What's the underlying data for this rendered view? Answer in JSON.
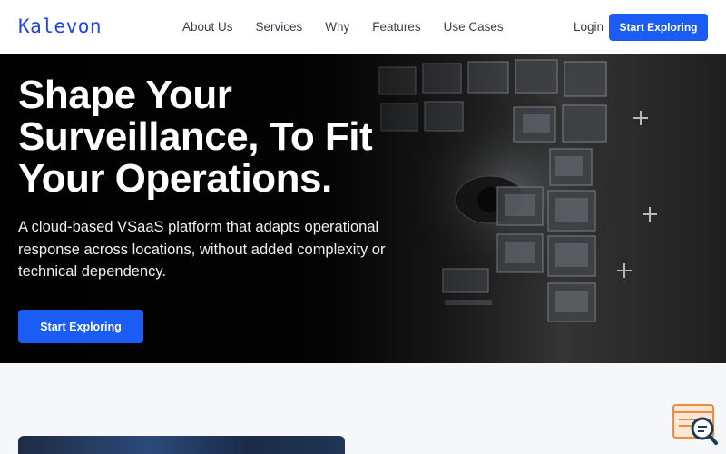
{
  "brand": {
    "logo_text": "Kalevon",
    "primary_color": "#1b5cf5"
  },
  "nav": {
    "links": [
      "About Us",
      "Services",
      "Why",
      "Features",
      "Use Cases"
    ],
    "login_label": "Login",
    "cta_label": "Start Exploring"
  },
  "hero": {
    "title_lines": [
      "Shape Your",
      "Surveillance, To Fit",
      "Your Operations."
    ],
    "subtitle": "A cloud-based VSaaS platform that adapts operational response across locations, without added complexity or technical dependency.",
    "cta_label": "Start Exploring"
  },
  "icons": {
    "chat_widget": "chat-search-icon"
  }
}
